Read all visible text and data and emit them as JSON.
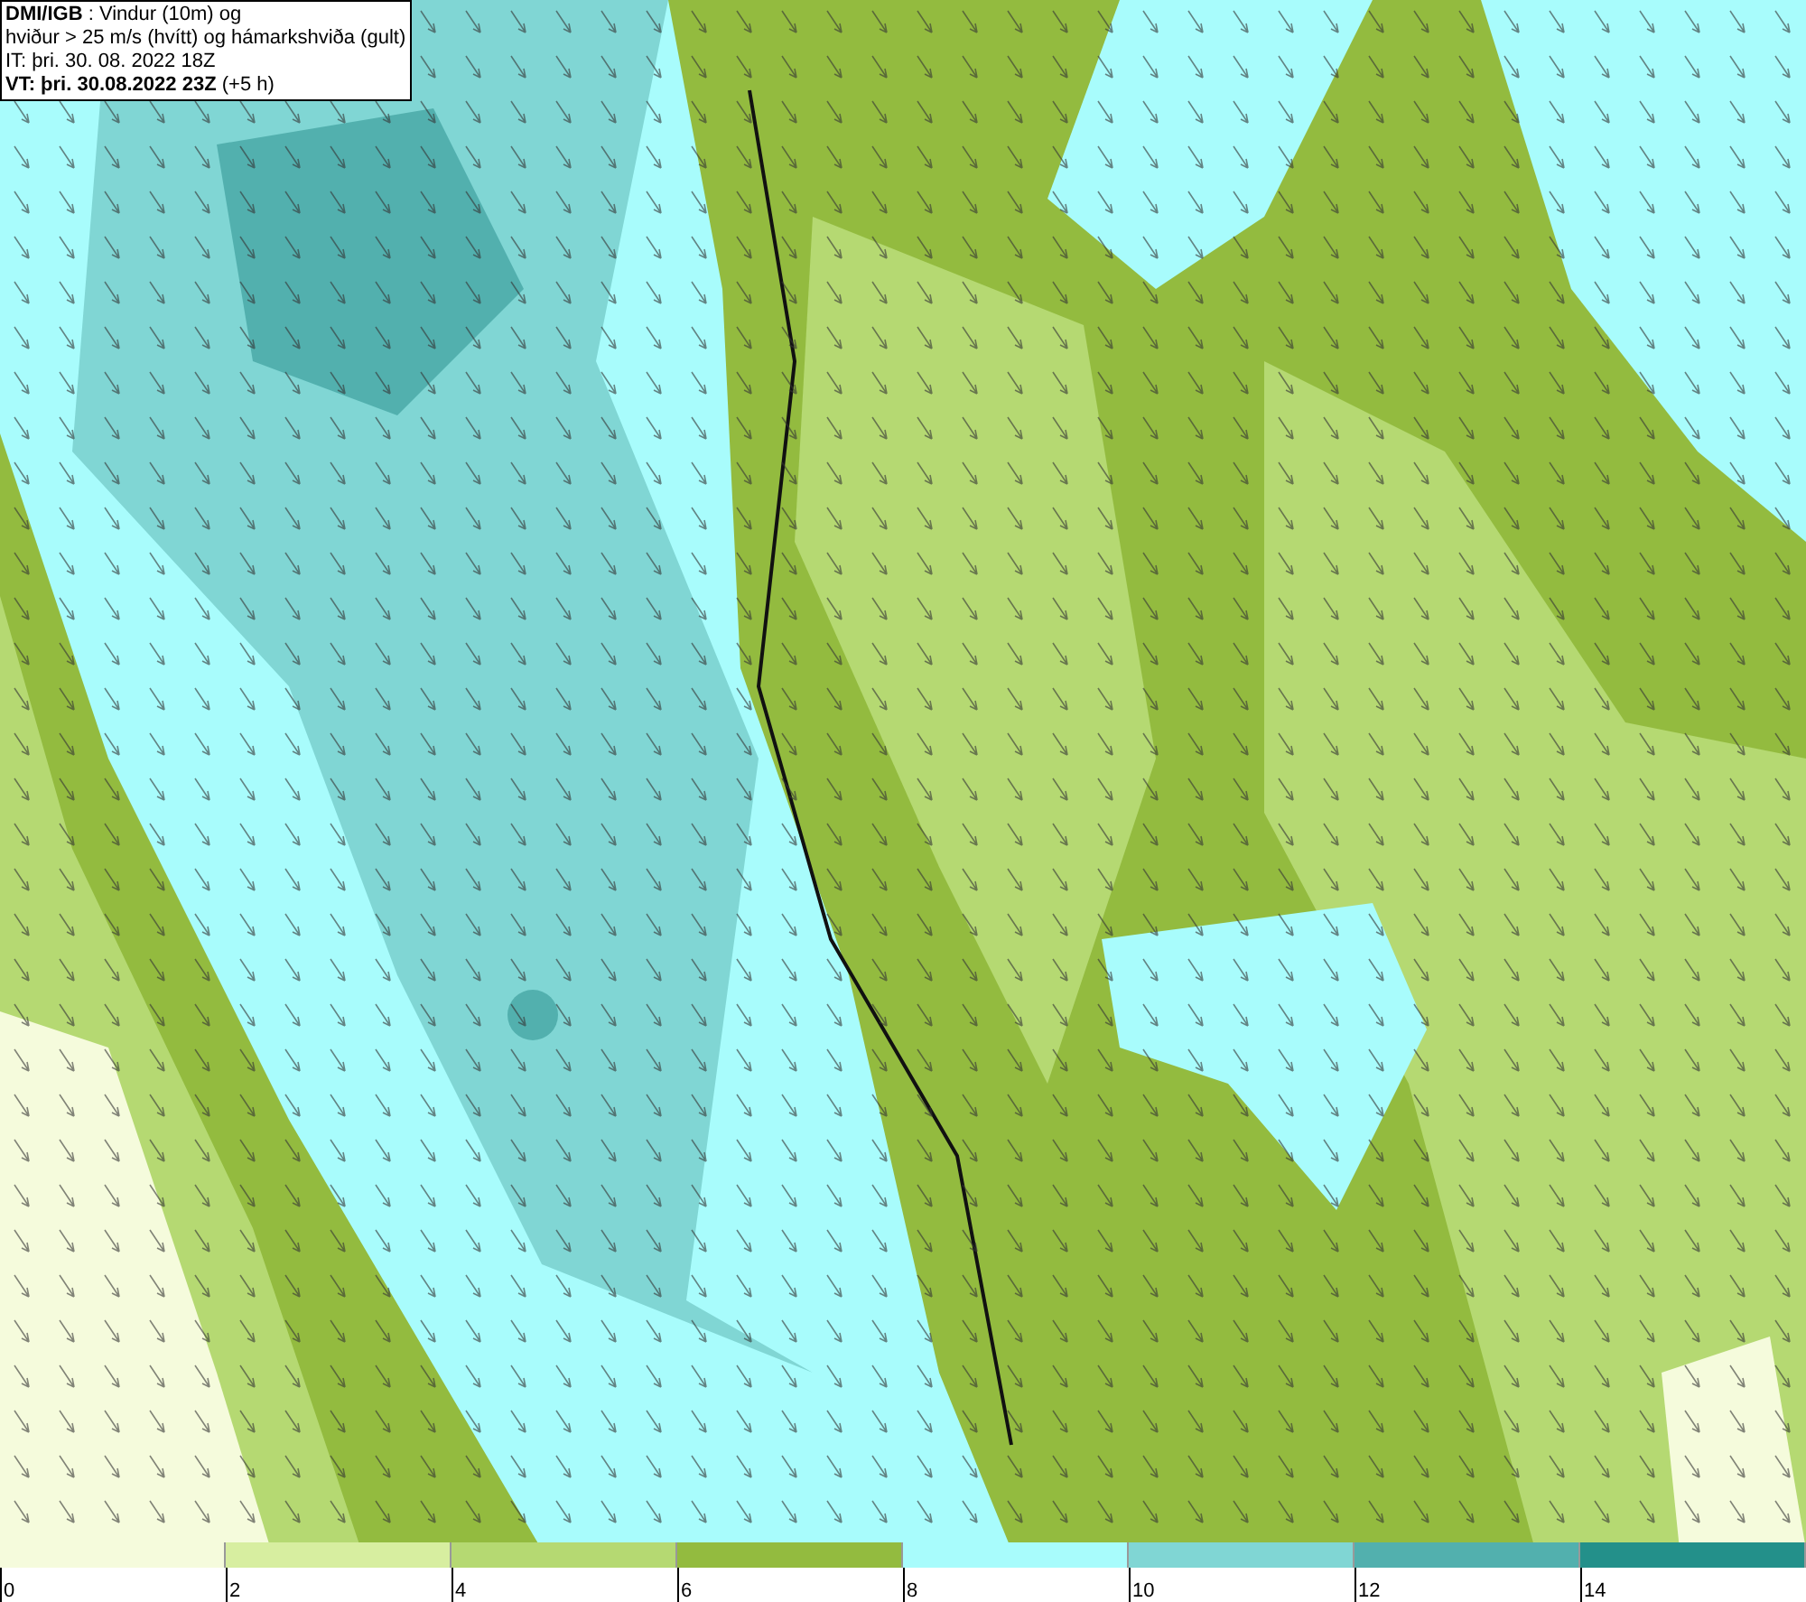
{
  "title_box": {
    "lines": [
      "**DMI/IGB** : Vindur (10m) og",
      "hviður > 25 m/s (hvítt) og hámarkshviða (gult)",
      "IT: þri. 30. 08. 2022 18Z",
      "**VT: þri. 30.08.2022 23Z** (+5 h)"
    ]
  },
  "legend": {
    "bins": [
      {
        "color": "#f5fbdc"
      },
      {
        "color": "#d7eea0"
      },
      {
        "color": "#b5d972"
      },
      {
        "color": "#93bb3f"
      },
      {
        "color": "#a8fcfc"
      },
      {
        "color": "#80d6d4"
      },
      {
        "color": "#52b0ae"
      },
      {
        "color": "#23908a"
      }
    ],
    "labels": [
      "0",
      "2",
      "4",
      "6",
      "8",
      "10",
      "12",
      "14"
    ]
  }
}
